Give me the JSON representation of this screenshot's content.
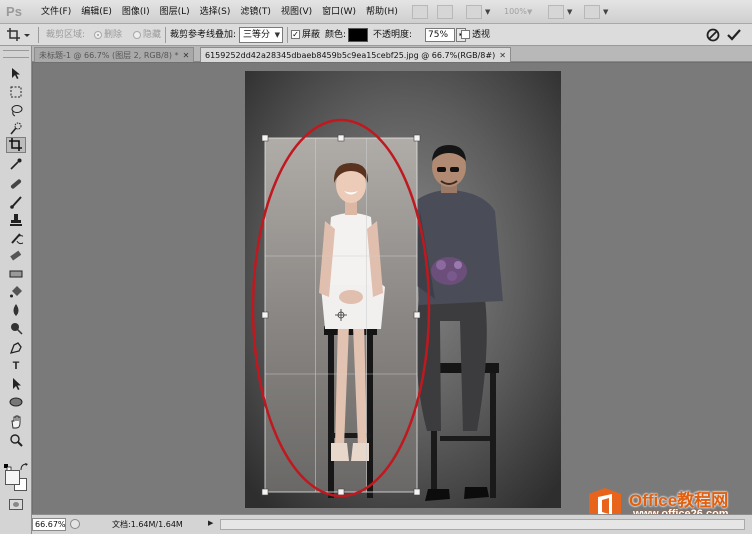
{
  "app": {
    "logo_text": "Ps"
  },
  "menu": {
    "items": [
      "文件(F)",
      "编辑(E)",
      "图像(I)",
      "图层(L)",
      "选择(S)",
      "滤镜(T)",
      "视图(V)",
      "窗口(W)",
      "帮助(H)"
    ],
    "zoom_display": "100%"
  },
  "options_bar": {
    "crop_area_label": "裁剪区域:",
    "delete_label": "删除",
    "hide_label": "隐藏",
    "overlay_label": "裁剪参考线叠加:",
    "overlay_value": "三等分",
    "shield_label": "屏蔽",
    "shield_checked": true,
    "color_label": "颜色:",
    "shield_color": "#000000",
    "opacity_label": "不透明度:",
    "opacity_value": "75%",
    "perspective_label": "透视",
    "perspective_checked": false
  },
  "tabs": [
    {
      "label": "未标题-1 @ 66.7% (图层 2, RGB/8) *",
      "active": false
    },
    {
      "label": "6159252dd42a28345dbaeb8459b5c9ea15cebf25.jpg @ 66.7%(RGB/8#)",
      "active": true
    }
  ],
  "tools": [
    "move-tool",
    "marquee-tool",
    "lasso-tool",
    "quick-selection-tool",
    "crop-tool",
    "eyedropper-tool",
    "healing-brush-tool",
    "brush-tool",
    "clone-stamp-tool",
    "history-brush-tool",
    "eraser-tool",
    "paint-bucket-tool",
    "blur-tool",
    "dodge-tool",
    "pen-tool",
    "type-tool",
    "path-selection-tool",
    "shape-tool",
    "hand-tool",
    "zoom-tool"
  ],
  "colors": {
    "foreground": "#f5f5f5",
    "background": "#ffffff",
    "annotation_ellipse": "#c0181f"
  },
  "status": {
    "zoom": "66.67%",
    "doc_info": "文档:1.64M/1.64M"
  },
  "watermark": {
    "title": "Office教程网",
    "url": "www.office26.com"
  }
}
